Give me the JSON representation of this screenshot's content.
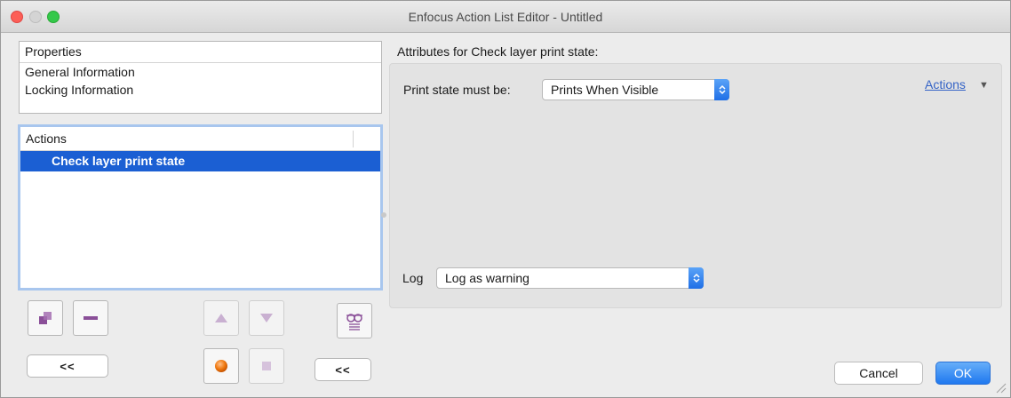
{
  "window": {
    "title": "Enfocus Action List Editor - Untitled"
  },
  "properties": {
    "header": "Properties",
    "items": [
      "General Information",
      "Locking Information"
    ]
  },
  "actions_list": {
    "header": "Actions",
    "items": [
      "Check layer print state"
    ],
    "selected_index": 0
  },
  "left_buttons": {
    "back1_label": "<<",
    "back2_label": "<<"
  },
  "attributes": {
    "heading": "Attributes for Check layer print state:",
    "print_state_label": "Print state must be:",
    "print_state_value": "Prints When Visible",
    "actions_menu_label": "Actions",
    "log_label": "Log",
    "log_value": "Log as warning"
  },
  "footer": {
    "cancel_label": "Cancel",
    "ok_label": "OK"
  },
  "colors": {
    "accent": "#1b5fd3",
    "link": "#3463c6",
    "record": "#f07a12",
    "icon_purple": "#8a4f98"
  }
}
